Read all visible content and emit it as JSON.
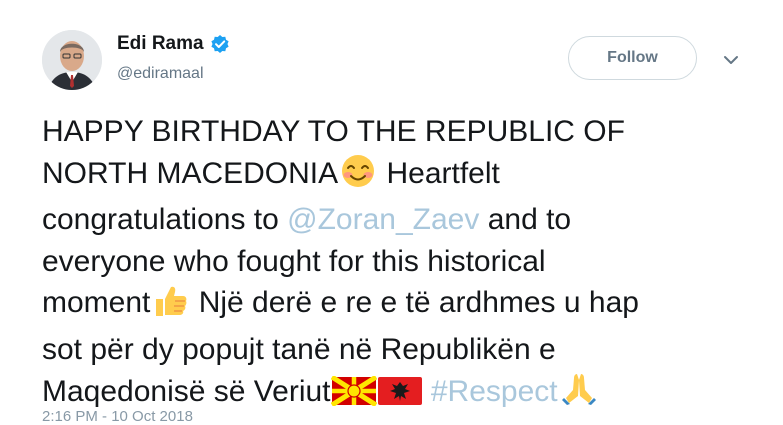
{
  "author": {
    "name": "Edi Rama",
    "handle": "@ediramaal",
    "verified": true
  },
  "follow_button": {
    "label": "Follow"
  },
  "tweet": {
    "text_a": "HAPPY BIRTHDAY TO THE REPUBLIC OF",
    "text_b": "NORTH MACEDONIA",
    "text_c": " Heartfelt",
    "text_d": "congratulations to ",
    "mention": "@Zoran_Zaev",
    "text_e": " and to",
    "text_f": "everyone who fought for this historical",
    "text_g": "moment",
    "text_h": " Një derë e re e të ardhmes u hap",
    "text_i": "sot për dy popujt tanë në Republikën e",
    "text_j": "Maqedonisë së Veriut",
    "hashtag": "#Respect"
  },
  "timestamp": "2:16 PM - 10 Oct 2018",
  "icons": [
    "verified-badge-icon",
    "chevron-down-icon",
    "smiling-face-emoji",
    "thumbs-up-emoji",
    "north-macedonia-flag-emoji",
    "albania-flag-emoji",
    "folded-hands-emoji"
  ],
  "colors": {
    "link": "#a9c7dc",
    "verified": "#1da1f2",
    "text": "#14171a",
    "secondary": "#657786"
  }
}
